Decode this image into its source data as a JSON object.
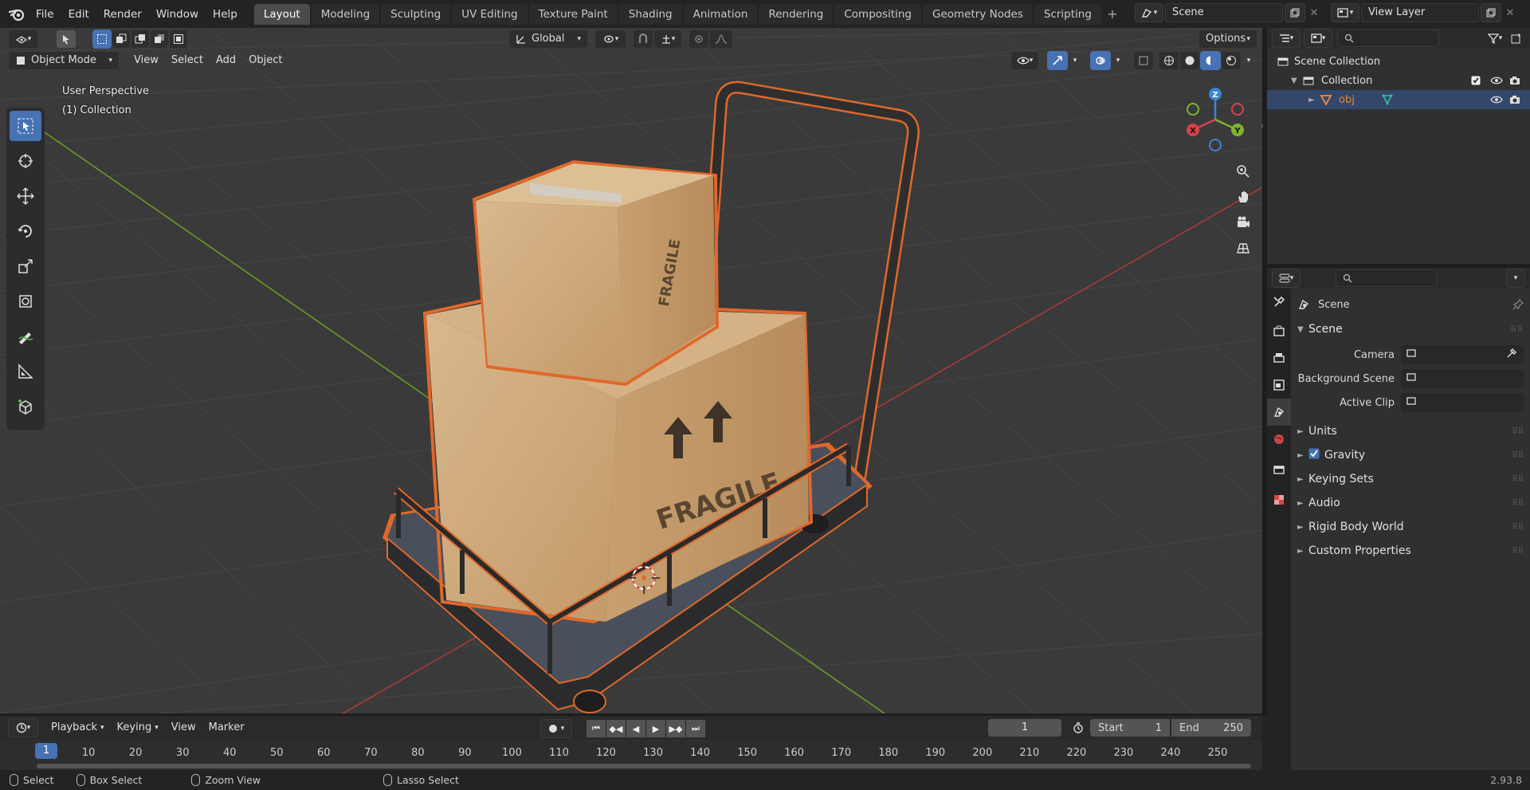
{
  "app": {
    "menus": [
      "File",
      "Edit",
      "Render",
      "Window",
      "Help"
    ],
    "workspaces": [
      "Layout",
      "Modeling",
      "Sculpting",
      "UV Editing",
      "Texture Paint",
      "Shading",
      "Animation",
      "Rendering",
      "Compositing",
      "Geometry Nodes",
      "Scripting"
    ],
    "active_workspace": "Layout",
    "scene_name": "Scene",
    "view_layer": "View Layer"
  },
  "viewport": {
    "transform_orientation": "Global",
    "options_label": "Options",
    "mode": "Object Mode",
    "menus": [
      "View",
      "Select",
      "Add",
      "Object"
    ],
    "overlay_title": "User Perspective",
    "overlay_subtitle": "(1) Collection",
    "gizmo": {
      "x": "X",
      "y": "Y",
      "z": "Z"
    },
    "box_text": "FRAGILE",
    "accent_selection": "#e0682a"
  },
  "outliner": {
    "root": "Scene Collection",
    "collection": "Collection",
    "object": "obj"
  },
  "properties": {
    "context": "Scene",
    "panel": "Scene",
    "fields": [
      {
        "label": "Camera"
      },
      {
        "label": "Background Scene"
      },
      {
        "label": "Active Clip"
      }
    ],
    "subpanels": [
      "Units",
      "Gravity",
      "Keying Sets",
      "Audio",
      "Rigid Body World",
      "Custom Properties"
    ],
    "gravity_enabled": true
  },
  "timeline": {
    "menus": [
      "Playback",
      "Keying",
      "View",
      "Marker"
    ],
    "current_frame": "1",
    "start_label": "Start",
    "start": "1",
    "end_label": "End",
    "end": "250",
    "ruler": [
      "1",
      "10",
      "20",
      "30",
      "40",
      "50",
      "60",
      "70",
      "80",
      "90",
      "100",
      "110",
      "120",
      "130",
      "140",
      "150",
      "160",
      "170",
      "180",
      "190",
      "200",
      "210",
      "220",
      "230",
      "240",
      "250"
    ]
  },
  "status": {
    "select": "Select",
    "box_select": "Box Select",
    "zoom_view": "Zoom View",
    "lasso_select": "Lasso Select",
    "version": "2.93.8"
  }
}
